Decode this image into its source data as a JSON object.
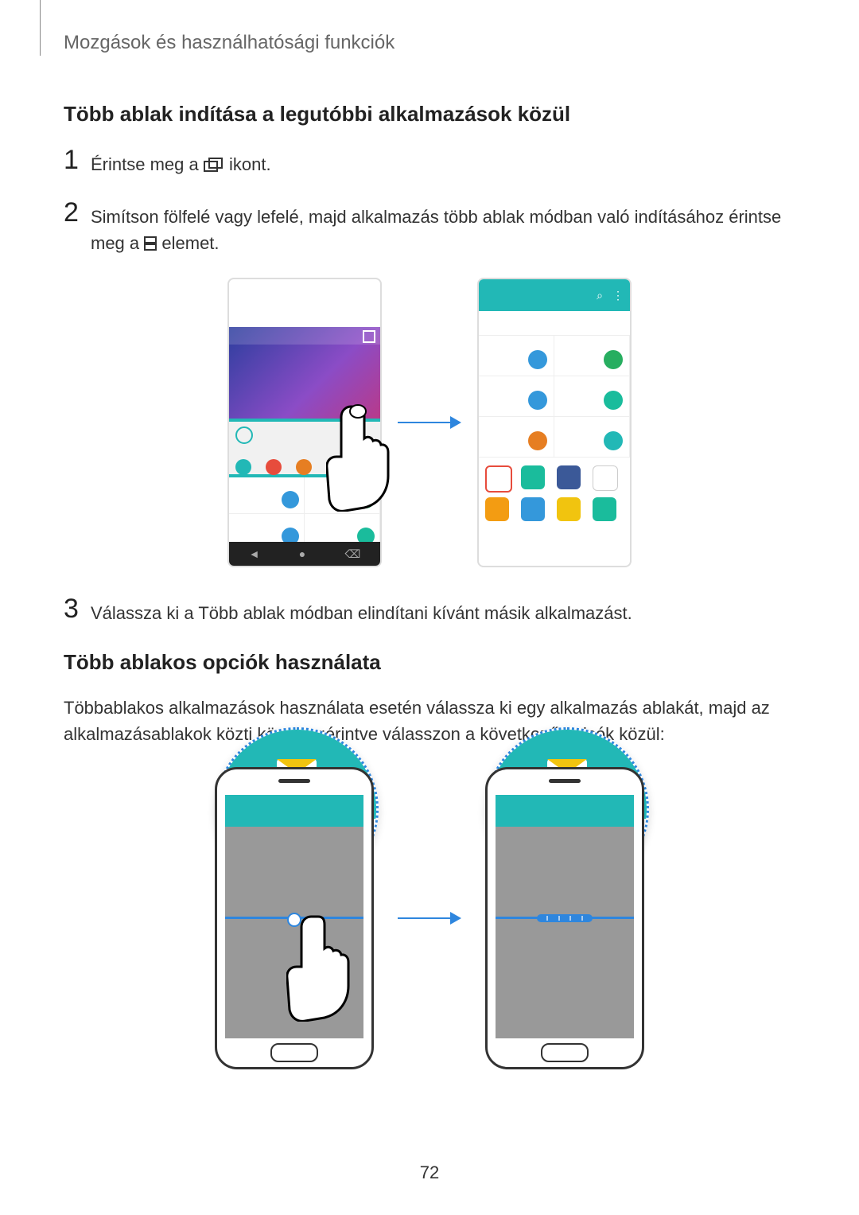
{
  "header": {
    "breadcrumb": "Mozgások és használhatósági funkciók"
  },
  "section1": {
    "heading": "Több ablak indítása a legutóbbi alkalmazások közül",
    "step1_num": "1",
    "step1_a": "Érintse meg a ",
    "step1_b": " ikont.",
    "step2_num": "2",
    "step2_a": "Simítson fölfelé vagy lefelé, majd alkalmazás több ablak módban való indításához érintse meg a ",
    "step2_b": " elemet.",
    "step3_num": "3",
    "step3_text": "Válassza ki a Több ablak módban elindítani kívánt másik alkalmazást."
  },
  "section2": {
    "heading": "Több ablakos opciók használata",
    "paragraph": "Többablakos alkalmazások használata esetén válassza ki egy alkalmazás ablakát, majd az alkalmazásablakok közti kört megérintve válasszon a következő opicók közül:"
  },
  "page_number": "72"
}
